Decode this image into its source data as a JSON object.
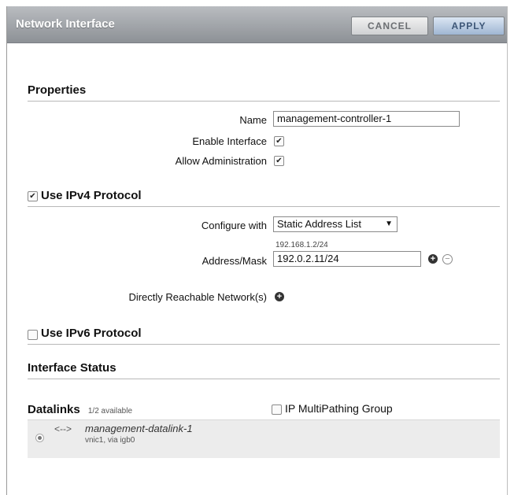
{
  "window": {
    "title": "Network Interface"
  },
  "toolbar": {
    "cancel_label": "CANCEL",
    "apply_label": "APPLY"
  },
  "properties": {
    "heading": "Properties",
    "name_label": "Name",
    "name_value": "management-controller-1",
    "enable_label": "Enable Interface",
    "enable_checked": true,
    "admin_label": "Allow Administration",
    "admin_checked": true
  },
  "ipv4": {
    "heading": "Use IPv4 Protocol",
    "checked": true,
    "configure_label": "Configure with",
    "configure_value": "Static Address List",
    "address_hint": "192.168.1.2/24",
    "address_label": "Address/Mask",
    "address_value": "192.0.2.11/24",
    "reachable_label": "Directly Reachable Network(s)"
  },
  "ipv6": {
    "heading": "Use IPv6 Protocol",
    "checked": false
  },
  "status": {
    "heading": "Interface Status"
  },
  "datalinks": {
    "heading": "Datalinks",
    "available": "1/2 available",
    "ipmp_label": "IP MultiPathing Group",
    "ipmp_checked": false,
    "items": [
      {
        "name": "management-datalink-1",
        "detail": "vnic1, via igb0",
        "icon": "bidirectional-arrow-icon"
      }
    ]
  }
}
